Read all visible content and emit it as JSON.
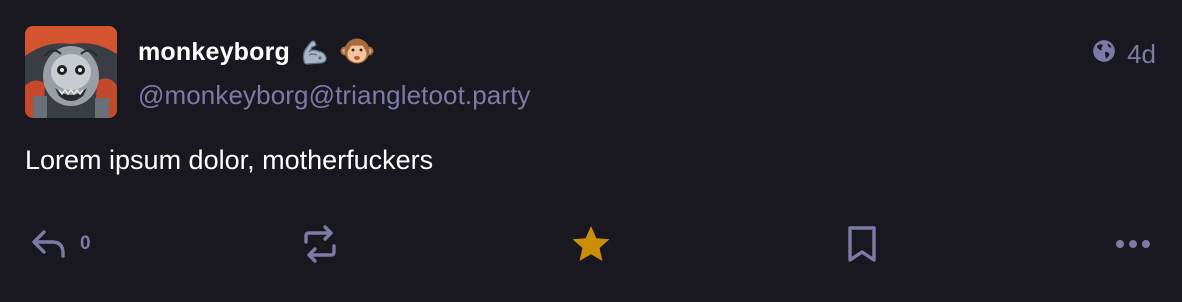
{
  "post": {
    "display_name": "monkeyborg",
    "emojis": [
      "flexed-biceps-mechanical-arm",
      "monkey-face"
    ],
    "handle": "@monkeyborg@triangletoot.party",
    "visibility_icon": "globe-icon",
    "time_ago": "4d",
    "content": "Lorem ipsum dolor, motherfuckers",
    "avatar_icon": "robot-monkey-avatar"
  },
  "actions": {
    "reply_count": "0",
    "favourited": true,
    "colors": {
      "muted": "#7d7aa6",
      "favourite": "#ca8f04",
      "background": "#191820"
    }
  }
}
